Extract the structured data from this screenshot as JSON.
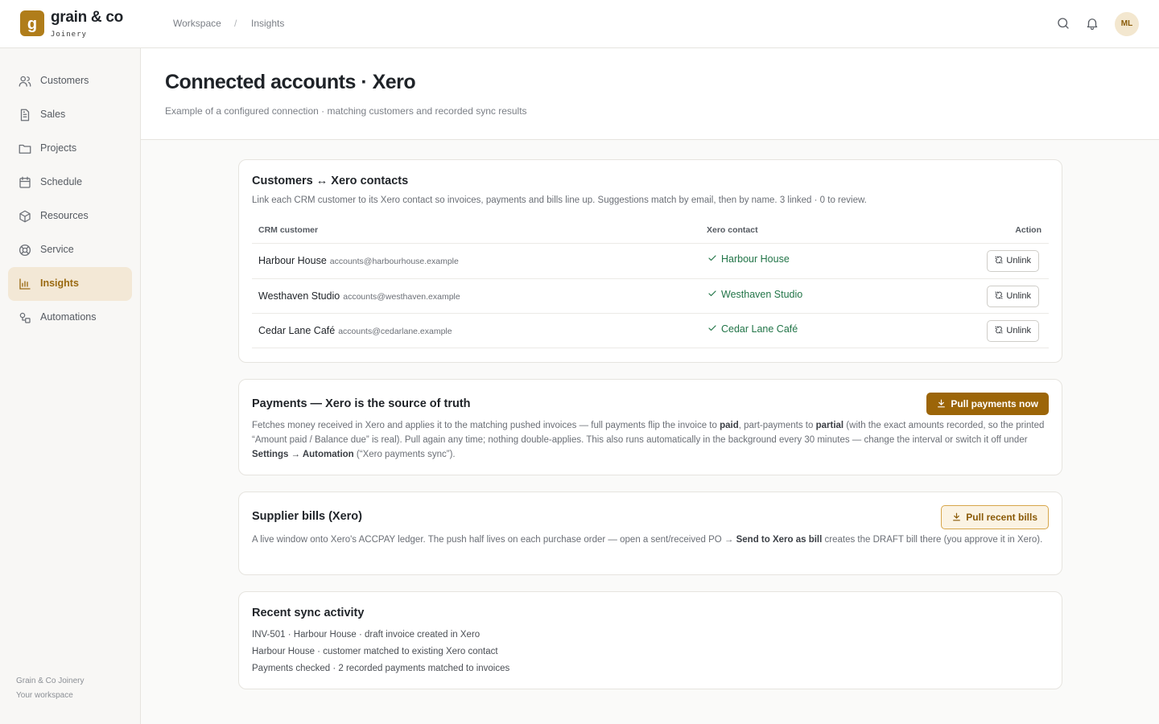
{
  "brand": {
    "mark": "g",
    "name": "grain & co",
    "sub": "Joinery"
  },
  "breadcrumb": {
    "workspace": "Workspace",
    "separator": "/",
    "current": "Insights"
  },
  "user": {
    "initials": "ML"
  },
  "sidebar": {
    "items": [
      {
        "label": "Customers",
        "icon": "users-icon"
      },
      {
        "label": "Sales",
        "icon": "document-icon"
      },
      {
        "label": "Projects",
        "icon": "folder-icon"
      },
      {
        "label": "Schedule",
        "icon": "calendar-icon"
      },
      {
        "label": "Resources",
        "icon": "box-icon"
      },
      {
        "label": "Service",
        "icon": "lifebuoy-icon"
      },
      {
        "label": "Insights",
        "icon": "bar-chart-icon",
        "active": true
      },
      {
        "label": "Automations",
        "icon": "automations-icon"
      }
    ],
    "footer_org": "Grain & Co Joinery",
    "footer_sub": "Your workspace"
  },
  "page": {
    "title": "Connected accounts · Xero",
    "subtitle": "Example of a configured connection · matching customers and recorded sync results"
  },
  "contacts_card": {
    "title": "Customers ↔ Xero contacts",
    "description": "Link each CRM customer to its Xero contact so invoices, payments and bills line up. Suggestions match by email, then by name. 3 linked · 0 to review.",
    "columns": {
      "customer": "CRM customer",
      "contact": "Xero contact",
      "action": "Action"
    },
    "rows": [
      {
        "name": "Harbour House",
        "email": "accounts@harbourhouse.example",
        "contact": "Harbour House",
        "action": "Unlink"
      },
      {
        "name": "Westhaven Studio",
        "email": "accounts@westhaven.example",
        "contact": "Westhaven Studio",
        "action": "Unlink"
      },
      {
        "name": "Cedar Lane Café",
        "email": "accounts@cedarlane.example",
        "contact": "Cedar Lane Café",
        "action": "Unlink"
      }
    ]
  },
  "payments_card": {
    "title": "Payments — Xero is the source of truth",
    "button": "Pull payments now",
    "desc_1": "Fetches money received in Xero and applies it to the matching pushed invoices — full payments flip the invoice to ",
    "desc_paid": "paid",
    "desc_2": ", part-payments to ",
    "desc_partial": "partial",
    "desc_3": " (with the exact amounts recorded, so the printed “Amount paid / Balance due” is real). Pull again any time; nothing double-applies. This also runs automatically in the background every 30 minutes — change the interval or switch it off under ",
    "desc_settings": "Settings → Automation",
    "desc_4": " (“Xero payments sync”)."
  },
  "bills_card": {
    "title": "Supplier bills (Xero)",
    "button": "Pull recent bills",
    "desc_1": "A live window onto Xero's ACCPAY ledger. The push half lives on each purchase order — open a sent/received PO → ",
    "desc_bold": "Send to Xero as bill",
    "desc_2": " creates the DRAFT bill there (you approve it in Xero)."
  },
  "activity_card": {
    "title": "Recent sync activity",
    "items": [
      "INV-501 · Harbour House · draft invoice created in Xero",
      "Harbour House · customer matched to existing Xero contact",
      "Payments checked · 2 recorded payments matched to invoices"
    ]
  },
  "colors": {
    "accent": "#9c6508",
    "active_bg": "#f3e8d6",
    "linked_green": "#227548"
  }
}
